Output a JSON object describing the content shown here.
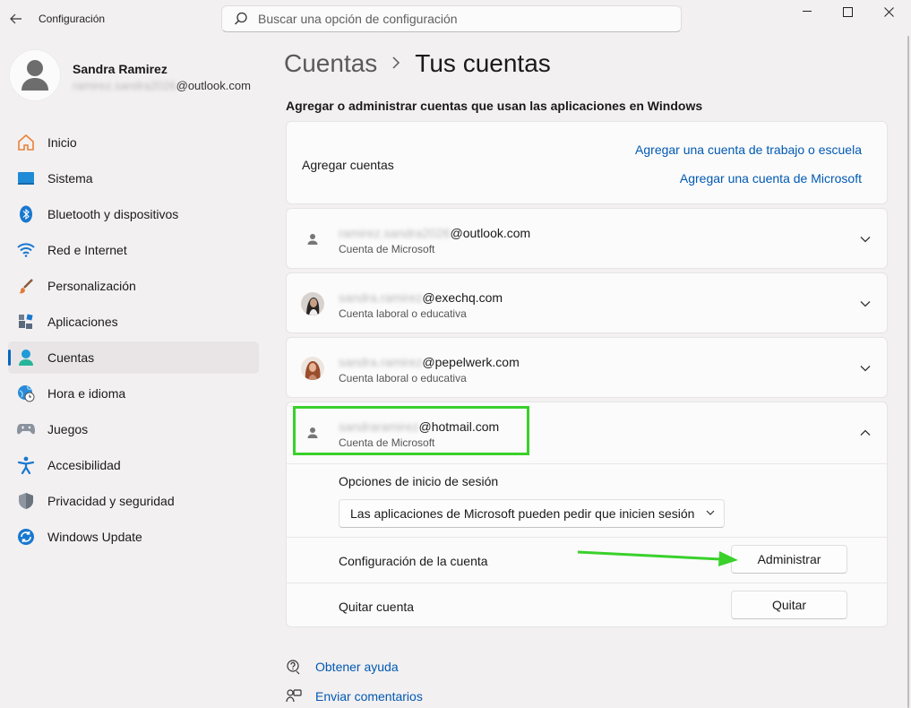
{
  "window": {
    "title": "Configuración",
    "controls": [
      "minimize-icon",
      "maximize-icon",
      "close-icon"
    ]
  },
  "search": {
    "placeholder": "Buscar una opción de configuración"
  },
  "profile": {
    "name": "Sandra Ramirez",
    "email_blurred": "ramirez.sandra2026",
    "email_domain": "@outlook.com"
  },
  "sidebar": {
    "items": [
      {
        "label": "Inicio",
        "icon": "home-icon"
      },
      {
        "label": "Sistema",
        "icon": "system-icon"
      },
      {
        "label": "Bluetooth y dispositivos",
        "icon": "bluetooth-icon"
      },
      {
        "label": "Red e Internet",
        "icon": "wifi-icon"
      },
      {
        "label": "Personalización",
        "icon": "brush-icon"
      },
      {
        "label": "Aplicaciones",
        "icon": "apps-icon"
      },
      {
        "label": "Cuentas",
        "icon": "accounts-icon",
        "active": true
      },
      {
        "label": "Hora e idioma",
        "icon": "globe-clock-icon"
      },
      {
        "label": "Juegos",
        "icon": "gamepad-icon"
      },
      {
        "label": "Accesibilidad",
        "icon": "accessibility-icon"
      },
      {
        "label": "Privacidad y seguridad",
        "icon": "shield-icon"
      },
      {
        "label": "Windows Update",
        "icon": "update-icon"
      }
    ]
  },
  "breadcrumb": {
    "parent": "Cuentas",
    "current": "Tus cuentas"
  },
  "section_title": "Agregar o administrar cuentas que usan las aplicaciones en Windows",
  "add_accounts": {
    "label": "Agregar cuentas",
    "link_work": "Agregar una cuenta de trabajo o escuela",
    "link_microsoft": "Agregar una cuenta de Microsoft"
  },
  "accounts": [
    {
      "email_blurred": "ramirez.sandra2026",
      "email_domain": "@outlook.com",
      "type": "Cuenta de Microsoft",
      "avatar": "person-icon",
      "expanded": false
    },
    {
      "email_blurred": "sandra.ramirez",
      "email_domain": "@exechq.com",
      "type": "Cuenta laboral o educativa",
      "avatar": "photo",
      "expanded": false
    },
    {
      "email_blurred": "sandra.ramirez",
      "email_domain": "@pepelwerk.com",
      "type": "Cuenta laboral o educativa",
      "avatar": "photo",
      "expanded": false
    },
    {
      "email_blurred": "sandraramirez",
      "email_domain": "@hotmail.com",
      "type": "Cuenta de Microsoft",
      "avatar": "person-icon",
      "expanded": true
    }
  ],
  "expanded_account": {
    "signin_options_label": "Opciones de inicio de sesión",
    "signin_dropdown_value": "Las aplicaciones de Microsoft pueden pedir que inicien sesión",
    "account_settings_label": "Configuración de la cuenta",
    "manage_button": "Administrar",
    "remove_label": "Quitar cuenta",
    "remove_button": "Quitar"
  },
  "footer": {
    "help": "Obtener ayuda",
    "feedback": "Enviar comentarios"
  },
  "colors": {
    "accent": "#0067c0",
    "link": "#0059b3",
    "highlight_green": "#39d12a",
    "background": "#f3f0f1"
  }
}
